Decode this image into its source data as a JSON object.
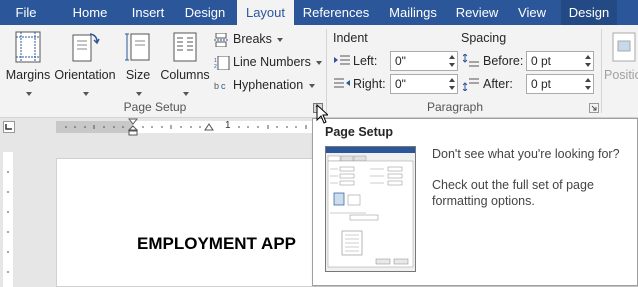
{
  "tabs": [
    {
      "label": "File",
      "active": false
    },
    {
      "label": "Home",
      "active": false
    },
    {
      "label": "Insert",
      "active": false
    },
    {
      "label": "Design",
      "active": false
    },
    {
      "label": "Layout",
      "active": true
    },
    {
      "label": "References",
      "active": false
    },
    {
      "label": "Mailings",
      "active": false
    },
    {
      "label": "Review",
      "active": false
    },
    {
      "label": "View",
      "active": false
    },
    {
      "label": "Design",
      "active": false
    }
  ],
  "page_setup": {
    "margins_label": "Margins",
    "orientation_label": "Orientation",
    "size_label": "Size",
    "columns_label": "Columns",
    "breaks_label": "Breaks",
    "line_numbers_label": "Line Numbers",
    "hyphenation_label": "Hyphenation",
    "group_label": "Page Setup"
  },
  "paragraph": {
    "indent_heading": "Indent",
    "left_label": "Left:",
    "left_value": "0\"",
    "right_label": "Right:",
    "right_value": "0\"",
    "spacing_heading": "Spacing",
    "before_label": "Before:",
    "before_value": "0 pt",
    "after_label": "After:",
    "after_value": "0 pt",
    "group_label": "Paragraph"
  },
  "arrange": {
    "position_label": "Positio"
  },
  "ruler": {
    "tick_label": "1"
  },
  "document": {
    "title": "EMPLOYMENT APP"
  },
  "tooltip": {
    "title": "Page Setup",
    "line1": "Don't see what you're looking for?",
    "line2": "Check out the full set of page formatting options."
  },
  "colors": {
    "tab_bar": "#2b579a",
    "ribbon": "#f3f3f3",
    "accent_icon": "#2b579a"
  }
}
